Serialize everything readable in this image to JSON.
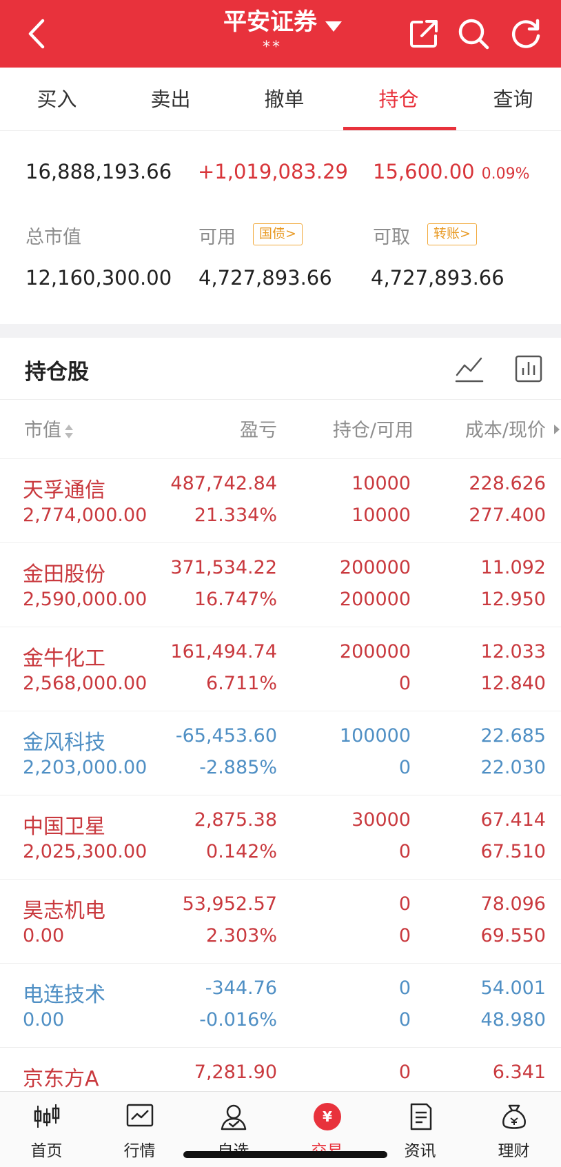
{
  "header": {
    "title": "平安证券",
    "account_masked": "**"
  },
  "tabs": [
    {
      "label": "买入"
    },
    {
      "label": "卖出"
    },
    {
      "label": "撤单"
    },
    {
      "label": "持仓"
    },
    {
      "label": "查询"
    }
  ],
  "summary": {
    "total_assets": "16,888,193.66",
    "total_pl": "+1,019,083.29",
    "today_pl": "15,600.00",
    "today_pl_pct": "0.09%",
    "market_value_label": "总市值",
    "market_value": "12,160,300.00",
    "available_label": "可用",
    "available_badge": "国债>",
    "available": "4,727,893.66",
    "withdrawable_label": "可取",
    "withdrawable_badge": "转账>",
    "withdrawable": "4,727,893.66"
  },
  "holdings": {
    "title": "持仓股",
    "columns": {
      "market_value": "市值",
      "pl": "盈亏",
      "position": "持仓/可用",
      "cost": "成本/现价"
    },
    "rows": [
      {
        "name": "天孚通信",
        "market_value": "2,774,000.00",
        "pl": "487,742.84",
        "pl_pct": "21.334%",
        "position": "10000",
        "available": "10000",
        "cost": "228.626",
        "price": "277.400",
        "trend": "up"
      },
      {
        "name": "金田股份",
        "market_value": "2,590,000.00",
        "pl": "371,534.22",
        "pl_pct": "16.747%",
        "position": "200000",
        "available": "200000",
        "cost": "11.092",
        "price": "12.950",
        "trend": "up"
      },
      {
        "name": "金牛化工",
        "market_value": "2,568,000.00",
        "pl": "161,494.74",
        "pl_pct": "6.711%",
        "position": "200000",
        "available": "0",
        "cost": "12.033",
        "price": "12.840",
        "trend": "up"
      },
      {
        "name": "金风科技",
        "market_value": "2,203,000.00",
        "pl": "-65,453.60",
        "pl_pct": "-2.885%",
        "position": "100000",
        "available": "0",
        "cost": "22.685",
        "price": "22.030",
        "trend": "down"
      },
      {
        "name": "中国卫星",
        "market_value": "2,025,300.00",
        "pl": "2,875.38",
        "pl_pct": "0.142%",
        "position": "30000",
        "available": "0",
        "cost": "67.414",
        "price": "67.510",
        "trend": "up"
      },
      {
        "name": "昊志机电",
        "market_value": "0.00",
        "pl": "53,952.57",
        "pl_pct": "2.303%",
        "position": "0",
        "available": "0",
        "cost": "78.096",
        "price": "69.550",
        "trend": "up"
      },
      {
        "name": "电连技术",
        "market_value": "0.00",
        "pl": "-344.76",
        "pl_pct": "-0.016%",
        "position": "0",
        "available": "0",
        "cost": "54.001",
        "price": "48.980",
        "trend": "down"
      },
      {
        "name": "京东方A",
        "market_value": "",
        "pl": "7,281.90",
        "pl_pct": "",
        "position": "0",
        "available": "",
        "cost": "6.341",
        "price": "",
        "trend": "up"
      }
    ]
  },
  "bottom_nav": [
    {
      "label": "首页",
      "icon": "candlestick-icon"
    },
    {
      "label": "行情",
      "icon": "market-chart-icon"
    },
    {
      "label": "自选",
      "icon": "user-watchlist-icon"
    },
    {
      "label": "交易",
      "icon": "trade-yen-icon",
      "glyph": "¥"
    },
    {
      "label": "资讯",
      "icon": "news-document-icon"
    },
    {
      "label": "理财",
      "icon": "money-bag-icon"
    }
  ],
  "colors": {
    "brand_red": "#e8323c",
    "gain_red": "#c9393e",
    "loss_blue": "#4f8fc4",
    "badge_orange": "#e89a25"
  }
}
